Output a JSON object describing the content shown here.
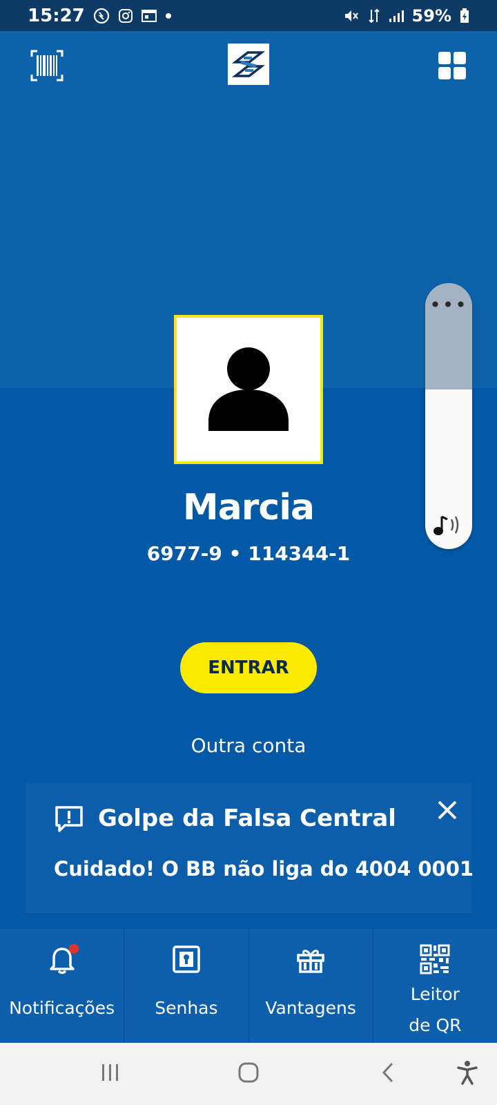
{
  "status_bar": {
    "time": "15:27",
    "battery": "59%",
    "icons": [
      "whatsapp-icon",
      "instagram-icon",
      "calendar-icon",
      "dot-icon",
      "mute-icon",
      "data-arrows-icon",
      "signal-icon",
      "battery-charging-icon"
    ]
  },
  "header": {
    "left_icon": "barcode-scanner-icon",
    "logo": "banco-do-brasil-logo",
    "right_icon": "apps-grid-icon"
  },
  "user": {
    "name": "Marcia",
    "account": "6977-9 • 114344-1"
  },
  "actions": {
    "enter_label": "ENTRAR",
    "other_account_label": "Outra conta"
  },
  "alert": {
    "title": "Golpe da Falsa Central",
    "message": "Cuidado! O BB não liga do 4004 0001",
    "icon": "message-alert-icon",
    "close_icon": "close-icon"
  },
  "volume_panel": {
    "menu_icon": "more-dots-icon",
    "media_icon": "media-volume-icon",
    "level": 0.6
  },
  "bottom_nav": {
    "items": [
      {
        "label": "Notificações",
        "icon": "bell-icon",
        "has_badge": true
      },
      {
        "label": "Senhas",
        "icon": "keyhole-icon"
      },
      {
        "label": "Vantagens",
        "icon": "gift-icon"
      },
      {
        "label": "Leitor de QR code",
        "icon": "qr-code-icon"
      }
    ]
  },
  "system_nav": {
    "buttons": [
      "recents-icon",
      "home-icon",
      "back-icon",
      "accessibility-icon"
    ]
  },
  "colors": {
    "brand_blue": "#0e62ab",
    "brand_yellow": "#fcea00",
    "status_bar": "#0e3a68"
  }
}
